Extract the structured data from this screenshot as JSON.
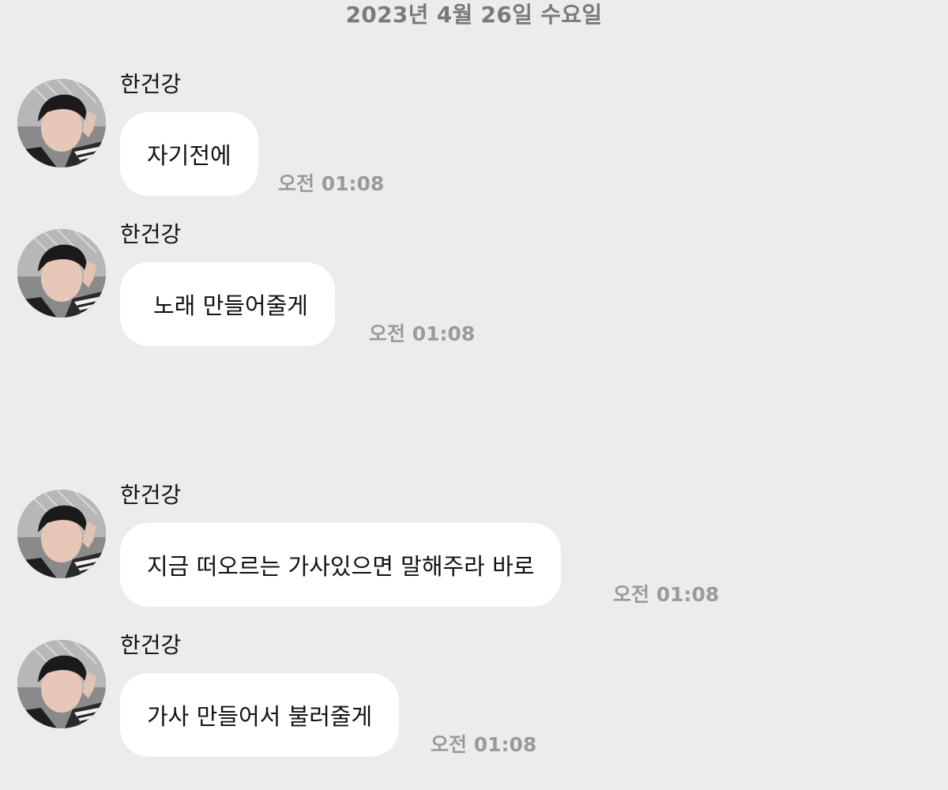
{
  "date_divider": "2023년 4월 26일 수요일",
  "messages": [
    {
      "sender": "한건강",
      "text": "자기전에",
      "time": "오전 01:08"
    },
    {
      "sender": "한건강",
      "text": "노래 만들어줄게",
      "time": "오전 01:08"
    },
    {
      "sender": "한건강",
      "text": "지금 떠오르는 가사있으면 말해주라 바로",
      "time": "오전 01:08"
    },
    {
      "sender": "한건강",
      "text": "가사 만들어서 불러줄게",
      "time": "오전 01:08"
    }
  ],
  "colors": {
    "background": "#ececec",
    "bubble": "#ffffff",
    "date_text": "#7a7a7a",
    "time_text": "#9a9a9a",
    "text": "#111111"
  },
  "icons": {
    "avatar": "profile-photo"
  }
}
